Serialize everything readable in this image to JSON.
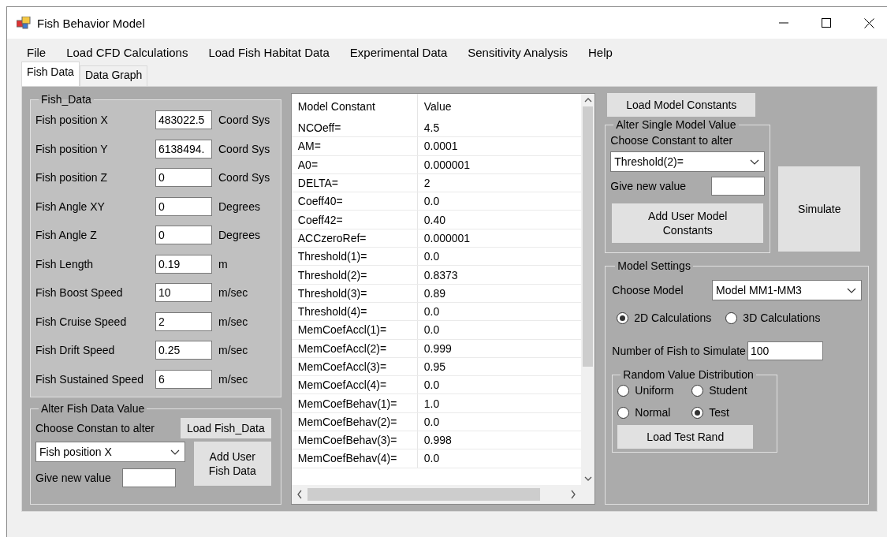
{
  "window": {
    "title": "Fish Behavior Model"
  },
  "menu": [
    "File",
    "Load CFD Calculations",
    "Load Fish Habitat Data",
    "Experimental Data",
    "Sensitivity Analysis",
    "Help"
  ],
  "tabs": [
    {
      "label": "Fish Data",
      "selected": true
    },
    {
      "label": "Data Graph",
      "selected": false
    }
  ],
  "fish_data": {
    "title": "Fish_Data",
    "fields": [
      {
        "label": "Fish position X",
        "value": "483022.5",
        "unit": "Coord Sys"
      },
      {
        "label": "Fish position Y",
        "value": "6138494.",
        "unit": "Coord Sys"
      },
      {
        "label": "Fish position Z",
        "value": "0",
        "unit": "Coord Sys"
      },
      {
        "label": "Fish Angle XY",
        "value": "0",
        "unit": "Degrees"
      },
      {
        "label": "Fish Angle Z",
        "value": "0",
        "unit": "Degrees"
      },
      {
        "label": "Fish Length",
        "value": "0.19",
        "unit": "m"
      },
      {
        "label": "Fish Boost Speed",
        "value": "10",
        "unit": "m/sec"
      },
      {
        "label": "Fish Cruise Speed",
        "value": "2",
        "unit": "m/sec"
      },
      {
        "label": "Fish Drift Speed",
        "value": "0.25",
        "unit": "m/sec"
      },
      {
        "label": "Fish Sustained Speed",
        "value": "6",
        "unit": "m/sec"
      }
    ]
  },
  "alter_fish": {
    "title": "Alter Fish Data Value",
    "choose_label": "Choose Constan to alter",
    "load_button": "Load Fish_Data",
    "dropdown": "Fish position X",
    "new_value_label": "Give new value",
    "add_button": "Add User Fish Data"
  },
  "constants_table": {
    "columns": [
      "Model Constant",
      "Value"
    ],
    "rows": [
      [
        "NCOeff=",
        "4.5"
      ],
      [
        "AM=",
        "0.0001"
      ],
      [
        "A0=",
        "0.000001"
      ],
      [
        "DELTA=",
        "2"
      ],
      [
        "Coeff40=",
        "0.0"
      ],
      [
        "Coeff42=",
        "0.40"
      ],
      [
        "ACCzeroRef=",
        "0.000001"
      ],
      [
        "Threshold(1)=",
        "0.0"
      ],
      [
        "Threshold(2)=",
        "0.8373"
      ],
      [
        "Threshold(3)=",
        "0.89"
      ],
      [
        "Threshold(4)=",
        "0.0"
      ],
      [
        "MemCoefAccl(1)=",
        "0.0"
      ],
      [
        "MemCoefAccl(2)=",
        "0.999"
      ],
      [
        "MemCoefAccl(3)=",
        "0.95"
      ],
      [
        "MemCoefAccl(4)=",
        "0.0"
      ],
      [
        "MemCoefBehav(1)=",
        "1.0"
      ],
      [
        "MemCoefBehav(2)=",
        "0.0"
      ],
      [
        "MemCoefBehav(3)=",
        "0.998"
      ],
      [
        "MemCoefBehav(4)=",
        "0.0"
      ]
    ]
  },
  "load_constants_button": "Load Model Constants",
  "alter_model": {
    "title": "Alter Single Model Value",
    "choose_label": "Choose Constant to alter",
    "dropdown": "Threshold(2)=",
    "new_value_label": "Give new value",
    "add_button": "Add User Model Constants"
  },
  "simulate_button": "Simulate",
  "model_settings": {
    "title": "Model Settings",
    "choose_label": "Choose Model",
    "model": "Model MM1-MM3",
    "calc_options": [
      {
        "label": "2D Calculations",
        "selected": true
      },
      {
        "label": "3D Calculations",
        "selected": false
      }
    ],
    "fish_count_label": "Number of Fish to Simulate",
    "fish_count": "100",
    "distribution": {
      "title": "Random Value Distribution",
      "options": [
        {
          "label": "Uniform",
          "selected": false
        },
        {
          "label": "Student",
          "selected": false
        },
        {
          "label": "Normal",
          "selected": false
        },
        {
          "label": "Test",
          "selected": true
        }
      ],
      "load_button": "Load Test Rand"
    }
  }
}
